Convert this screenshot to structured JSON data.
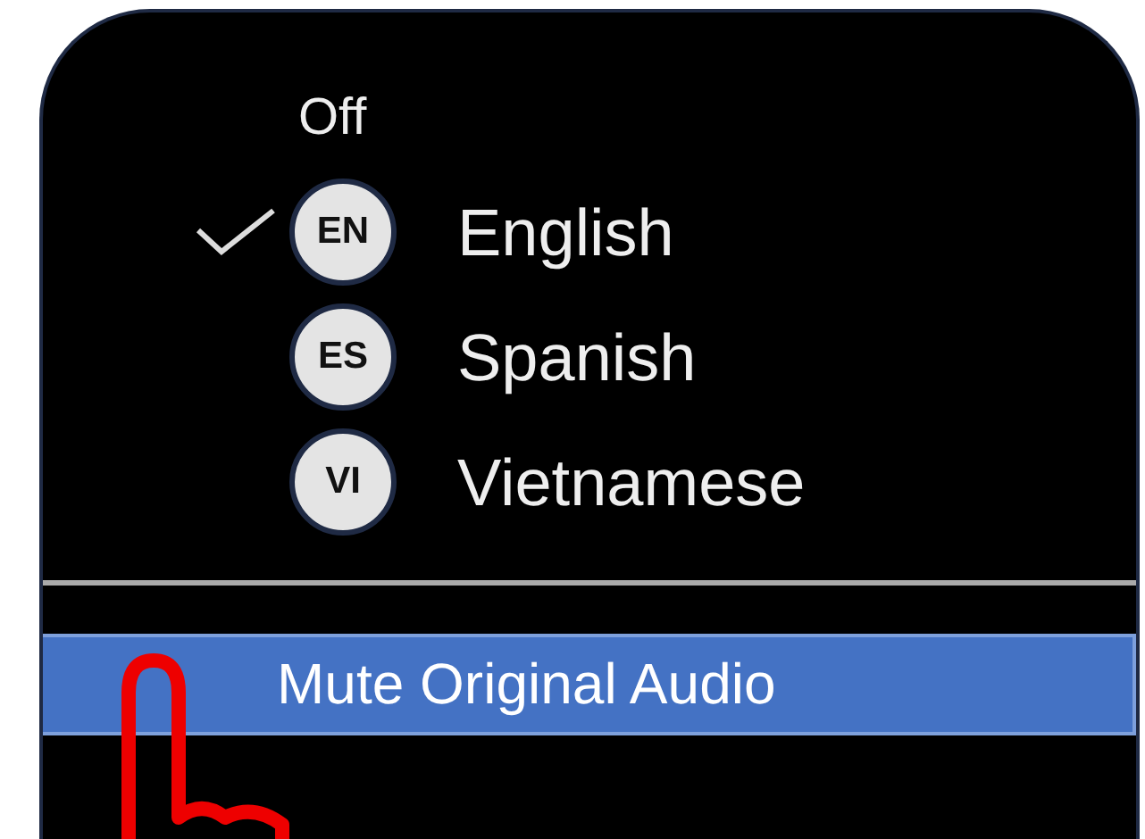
{
  "menu": {
    "options": [
      {
        "kind": "plain",
        "label": "Off",
        "selected": false
      },
      {
        "kind": "language",
        "code": "EN",
        "label": "English",
        "selected": true
      },
      {
        "kind": "language",
        "code": "ES",
        "label": "Spanish",
        "selected": false
      },
      {
        "kind": "language",
        "code": "VI",
        "label": "Vietnamese",
        "selected": false
      }
    ],
    "action": {
      "label": "Mute Original Audio",
      "highlighted": true
    }
  }
}
